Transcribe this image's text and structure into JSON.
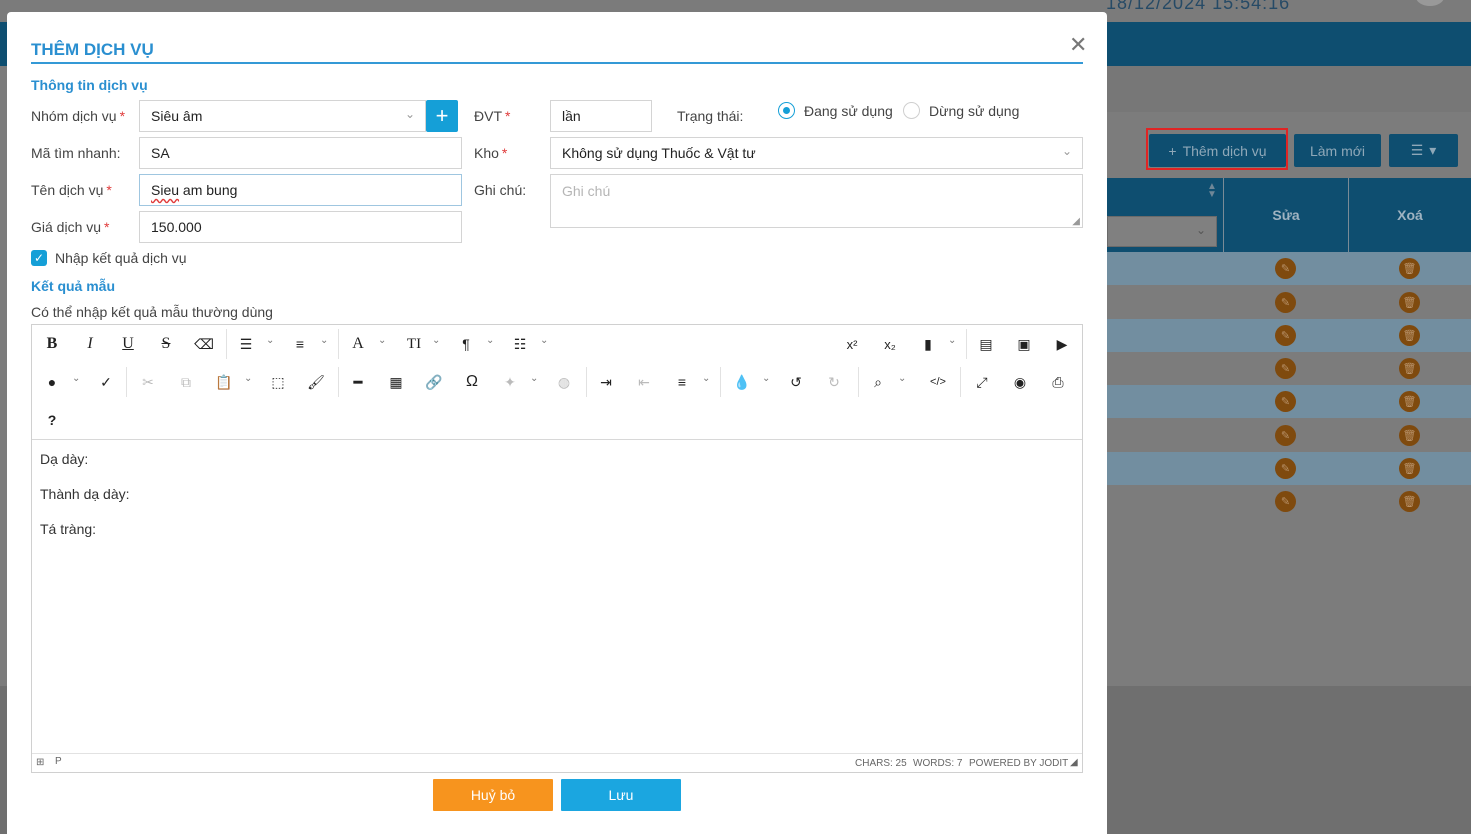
{
  "background": {
    "datetime": "18/12/2024 15:54:16",
    "toolbar": {
      "add_service": "Thêm dịch vụ",
      "refresh": "Làm mới"
    },
    "table": {
      "col_edit": "Sửa",
      "col_delete": "Xoá"
    }
  },
  "modal": {
    "title": "THÊM DỊCH VỤ",
    "section_info": "Thông tin dịch vụ",
    "group": {
      "label": "Nhóm dịch vụ",
      "value": "Siêu âm"
    },
    "quick_code": {
      "label": "Mã tìm nhanh:",
      "value": "SA"
    },
    "service_name": {
      "label": "Tên dịch vụ",
      "value_prefix": "Sieu",
      "value_suffix": " am bung"
    },
    "price": {
      "label": "Giá dịch vụ",
      "value": "150.000"
    },
    "unit": {
      "label": "ĐVT",
      "value": "lần"
    },
    "status": {
      "label": "Trạng thái:",
      "option_active": "Đang sử dụng",
      "option_inactive": "Dừng sử dụng",
      "selected": "Đang sử dụng"
    },
    "warehouse": {
      "label": "Kho",
      "value": "Không sử dụng Thuốc & Vật tư"
    },
    "note": {
      "label": "Ghi chú:",
      "placeholder": "Ghi chú"
    },
    "enter_result_checkbox": {
      "label": "Nhập kết quả dịch vụ",
      "checked": true
    },
    "section_template": "Kết quả mẫu",
    "template_hint": "Có thể nhập kết quả mẫu thường dùng",
    "editor": {
      "toolbar_row3": "?",
      "content_lines": [
        "Dạ dày:",
        "Thành dạ dày:",
        "Tá tràng:"
      ],
      "status_path": "P",
      "chars": "CHARS: 25",
      "words": "WORDS: 7",
      "powered": "POWERED BY JODIT"
    },
    "cancel_label": "Huỷ bỏ",
    "save_label": "Lưu",
    "colors": {
      "accent": "#159fd7",
      "title": "#2a8fd0",
      "cancel": "#f7941e",
      "save": "#1ba6e0"
    }
  }
}
